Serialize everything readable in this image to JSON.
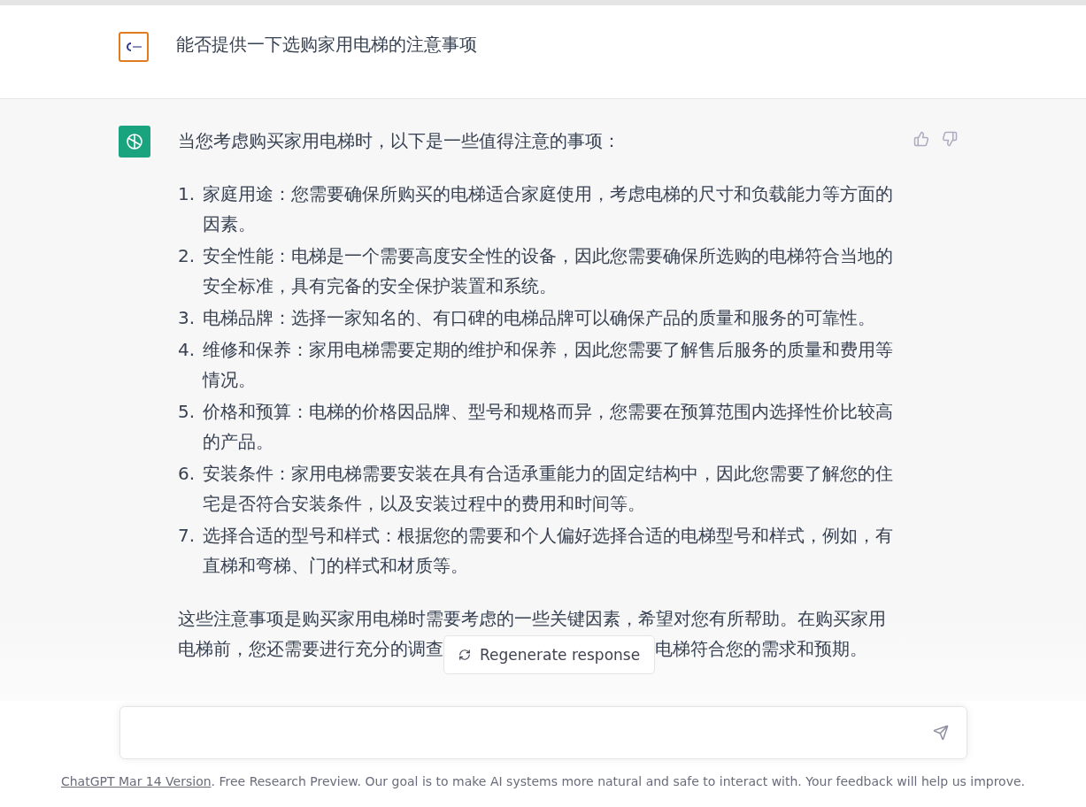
{
  "user_message": {
    "text": "能否提供一下选购家用电梯的注意事项"
  },
  "assistant_message": {
    "intro": "当您考虑购买家用电梯时，以下是一些值得注意的事项：",
    "items": [
      {
        "number": "1.",
        "text": "家庭用途：您需要确保所购买的电梯适合家庭使用，考虑电梯的尺寸和负载能力等方面的因素。"
      },
      {
        "number": "2.",
        "text": "安全性能：电梯是一个需要高度安全性的设备，因此您需要确保所选购的电梯符合当地的安全标准，具有完备的安全保护装置和系统。"
      },
      {
        "number": "3.",
        "text": "电梯品牌：选择一家知名的、有口碑的电梯品牌可以确保产品的质量和服务的可靠性。"
      },
      {
        "number": "4.",
        "text": "维修和保养：家用电梯需要定期的维护和保养，因此您需要了解售后服务的质量和费用等情况。"
      },
      {
        "number": "5.",
        "text": "价格和预算：电梯的价格因品牌、型号和规格而异，您需要在预算范围内选择性价比较高的产品。"
      },
      {
        "number": "6.",
        "text": "安装条件：家用电梯需要安装在具有合适承重能力的固定结构中，因此您需要了解您的住宅是否符合安装条件，以及安装过程中的费用和时间等。"
      },
      {
        "number": "7.",
        "text": "选择合适的型号和样式：根据您的需要和个人偏好选择合适的电梯型号和样式，例如，有直梯和弯梯、门的样式和材质等。"
      }
    ],
    "closing_line_1": "这些注意事项是购买家用电梯时需要考虑的一些关键因素，希望对您有所帮助。在购买家用",
    "closing_line_2_start": "电梯前，您还需要进行充分的调查",
    "closing_line_2_end": "电梯符合您的需求和预期。"
  },
  "regenerate_button": {
    "label": "Regenerate response"
  },
  "footer": {
    "link": "ChatGPT Mar 14 Version",
    "text": ". Free Research Preview. Our goal is to make AI systems more natural and safe to interact with. Your feedback will help us improve."
  }
}
